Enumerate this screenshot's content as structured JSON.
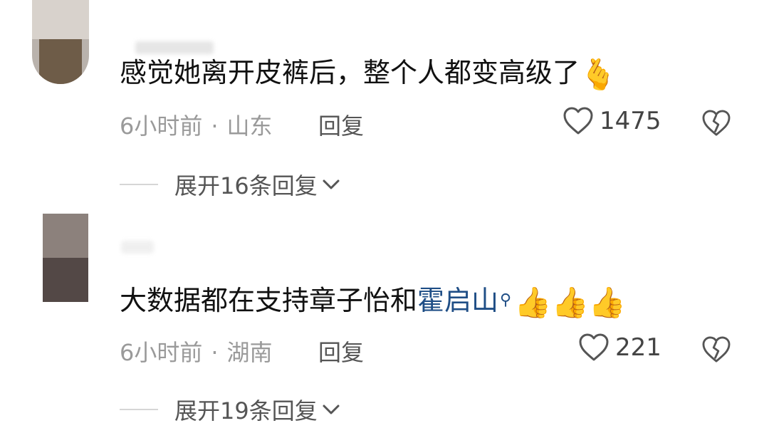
{
  "comments": [
    {
      "text": "感觉她离开皮裤后，整个人都变高级了",
      "emoji": "🫰",
      "time": "6小时前",
      "separator": "·",
      "location": "山东",
      "reply_label": "回复",
      "likes": "1475",
      "expand_label": "展开16条回复",
      "icons": {
        "like": "heart-outline-icon",
        "dislike": "broken-heart-icon",
        "expand": "chevron-down-icon"
      }
    },
    {
      "text": "大数据都在支持章子怡和",
      "link_text": "霍启山",
      "link_icon": "⚲",
      "emojis": "👍👍👍",
      "time": "6小时前",
      "separator": "·",
      "location": "湖南",
      "reply_label": "回复",
      "likes": "221",
      "expand_label": "展开19条回复",
      "icons": {
        "like": "heart-outline-icon",
        "dislike": "broken-heart-icon",
        "expand": "chevron-down-icon"
      }
    }
  ],
  "colors": {
    "link": "#1f4e86",
    "meta": "#9a9a9a",
    "text": "#111111"
  }
}
